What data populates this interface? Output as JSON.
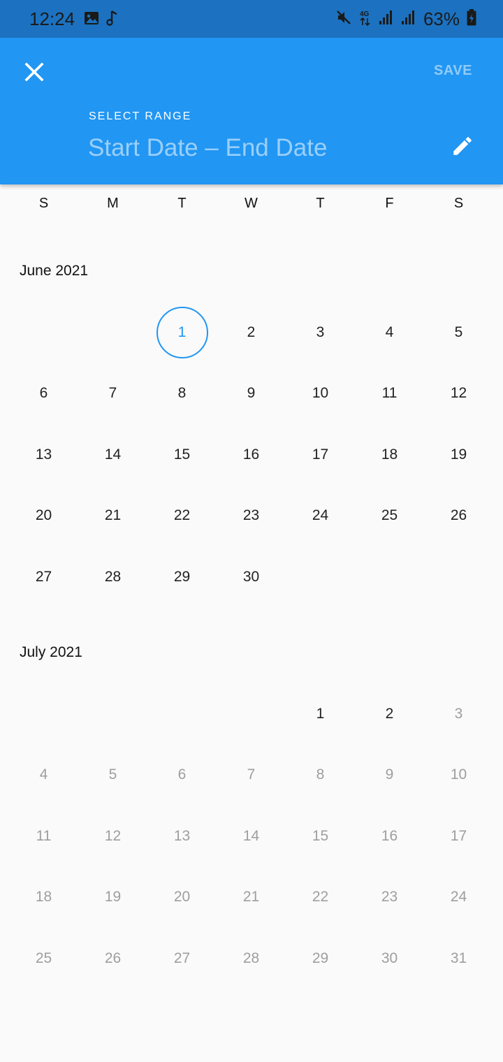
{
  "status_bar": {
    "time": "12:24",
    "battery_pct": "63%",
    "left_icons": [
      "image-icon",
      "music-note-icon"
    ],
    "right_icons": [
      "mute-icon",
      "4g-icon",
      "signal-icon",
      "signal-icon",
      "battery-icon"
    ]
  },
  "header": {
    "save_label": "SAVE",
    "range_label": "SELECT RANGE",
    "range_value": "Start Date – End Date",
    "colors": {
      "app_bar": "#2196f3",
      "status_bar": "#1c72c0"
    }
  },
  "weekdays": [
    "S",
    "M",
    "T",
    "W",
    "T",
    "F",
    "S"
  ],
  "months": [
    {
      "title": "June 2021",
      "leading_blanks": 2,
      "days": [
        {
          "label": "1",
          "state": "today"
        },
        {
          "label": "2",
          "state": "enabled"
        },
        {
          "label": "3",
          "state": "enabled"
        },
        {
          "label": "4",
          "state": "enabled"
        },
        {
          "label": "5",
          "state": "enabled"
        },
        {
          "label": "6",
          "state": "enabled"
        },
        {
          "label": "7",
          "state": "enabled"
        },
        {
          "label": "8",
          "state": "enabled"
        },
        {
          "label": "9",
          "state": "enabled"
        },
        {
          "label": "10",
          "state": "enabled"
        },
        {
          "label": "11",
          "state": "enabled"
        },
        {
          "label": "12",
          "state": "enabled"
        },
        {
          "label": "13",
          "state": "enabled"
        },
        {
          "label": "14",
          "state": "enabled"
        },
        {
          "label": "15",
          "state": "enabled"
        },
        {
          "label": "16",
          "state": "enabled"
        },
        {
          "label": "17",
          "state": "enabled"
        },
        {
          "label": "18",
          "state": "enabled"
        },
        {
          "label": "19",
          "state": "enabled"
        },
        {
          "label": "20",
          "state": "enabled"
        },
        {
          "label": "21",
          "state": "enabled"
        },
        {
          "label": "22",
          "state": "enabled"
        },
        {
          "label": "23",
          "state": "enabled"
        },
        {
          "label": "24",
          "state": "enabled"
        },
        {
          "label": "25",
          "state": "enabled"
        },
        {
          "label": "26",
          "state": "enabled"
        },
        {
          "label": "27",
          "state": "enabled"
        },
        {
          "label": "28",
          "state": "enabled"
        },
        {
          "label": "29",
          "state": "enabled"
        },
        {
          "label": "30",
          "state": "enabled"
        }
      ]
    },
    {
      "title": "July 2021",
      "leading_blanks": 4,
      "days": [
        {
          "label": "1",
          "state": "enabled"
        },
        {
          "label": "2",
          "state": "enabled"
        },
        {
          "label": "3",
          "state": "disabled"
        },
        {
          "label": "4",
          "state": "disabled"
        },
        {
          "label": "5",
          "state": "disabled"
        },
        {
          "label": "6",
          "state": "disabled"
        },
        {
          "label": "7",
          "state": "disabled"
        },
        {
          "label": "8",
          "state": "disabled"
        },
        {
          "label": "9",
          "state": "disabled"
        },
        {
          "label": "10",
          "state": "disabled"
        },
        {
          "label": "11",
          "state": "disabled"
        },
        {
          "label": "12",
          "state": "disabled"
        },
        {
          "label": "13",
          "state": "disabled"
        },
        {
          "label": "14",
          "state": "disabled"
        },
        {
          "label": "15",
          "state": "disabled"
        },
        {
          "label": "16",
          "state": "disabled"
        },
        {
          "label": "17",
          "state": "disabled"
        },
        {
          "label": "18",
          "state": "disabled"
        },
        {
          "label": "19",
          "state": "disabled"
        },
        {
          "label": "20",
          "state": "disabled"
        },
        {
          "label": "21",
          "state": "disabled"
        },
        {
          "label": "22",
          "state": "disabled"
        },
        {
          "label": "23",
          "state": "disabled"
        },
        {
          "label": "24",
          "state": "disabled"
        },
        {
          "label": "25",
          "state": "disabled"
        },
        {
          "label": "26",
          "state": "disabled"
        },
        {
          "label": "27",
          "state": "disabled"
        },
        {
          "label": "28",
          "state": "disabled"
        },
        {
          "label": "29",
          "state": "disabled"
        },
        {
          "label": "30",
          "state": "disabled"
        },
        {
          "label": "31",
          "state": "disabled"
        }
      ]
    }
  ]
}
